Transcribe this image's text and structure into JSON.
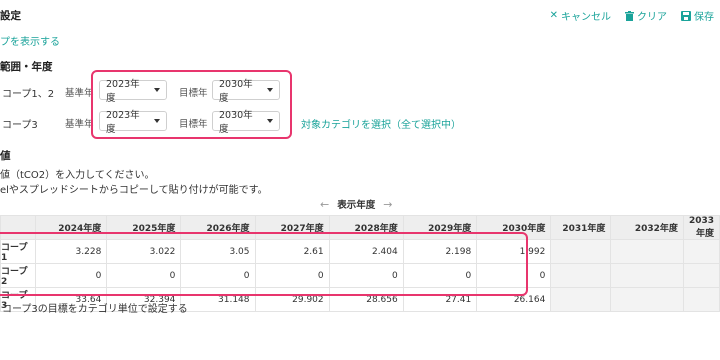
{
  "header": {
    "title": "設定"
  },
  "toolbar": {
    "cancel_label": "キャンセル",
    "clear_label": "クリア",
    "save_label": "保存"
  },
  "map_link": "プを表示する",
  "scope_section": {
    "title": "範囲・年度",
    "rows": [
      {
        "label": "コープ1、2",
        "base_label": "基準年",
        "base_value": "2023年度",
        "target_label": "目標年",
        "target_value": "2030年度"
      },
      {
        "label": "コープ3",
        "base_label": "基準年",
        "base_value": "2023年度",
        "target_label": "目標年",
        "target_value": "2030年度"
      }
    ],
    "category_link": "対象カテゴリを選択（全て選択中）"
  },
  "values_section": {
    "title": "値",
    "instruction1": "値（tCO2）を入力してください。",
    "instruction2": "elやスプレッドシートからコピーして貼り付けが可能です。"
  },
  "year_nav": {
    "label": "表示年度"
  },
  "table": {
    "headers": [
      "",
      "2024年度",
      "2025年度",
      "2026年度",
      "2027年度",
      "2028年度",
      "2029年度",
      "2030年度",
      "2031年度",
      "2032年度",
      "2033年度"
    ],
    "rows": [
      {
        "label": "コープ1",
        "values": [
          "3.228",
          "3.022",
          "3.05",
          "2.61",
          "2.404",
          "2.198",
          "1.992"
        ]
      },
      {
        "label": "コープ2",
        "values": [
          "0",
          "0",
          "0",
          "0",
          "0",
          "0",
          "0"
        ]
      },
      {
        "label": "コープ3",
        "values": [
          "33.64",
          "32.394",
          "31.148",
          "29.902",
          "28.656",
          "27.41",
          "26.164"
        ]
      }
    ]
  },
  "footer_option": "コープ3の目標をカテゴリ単位で設定する"
}
